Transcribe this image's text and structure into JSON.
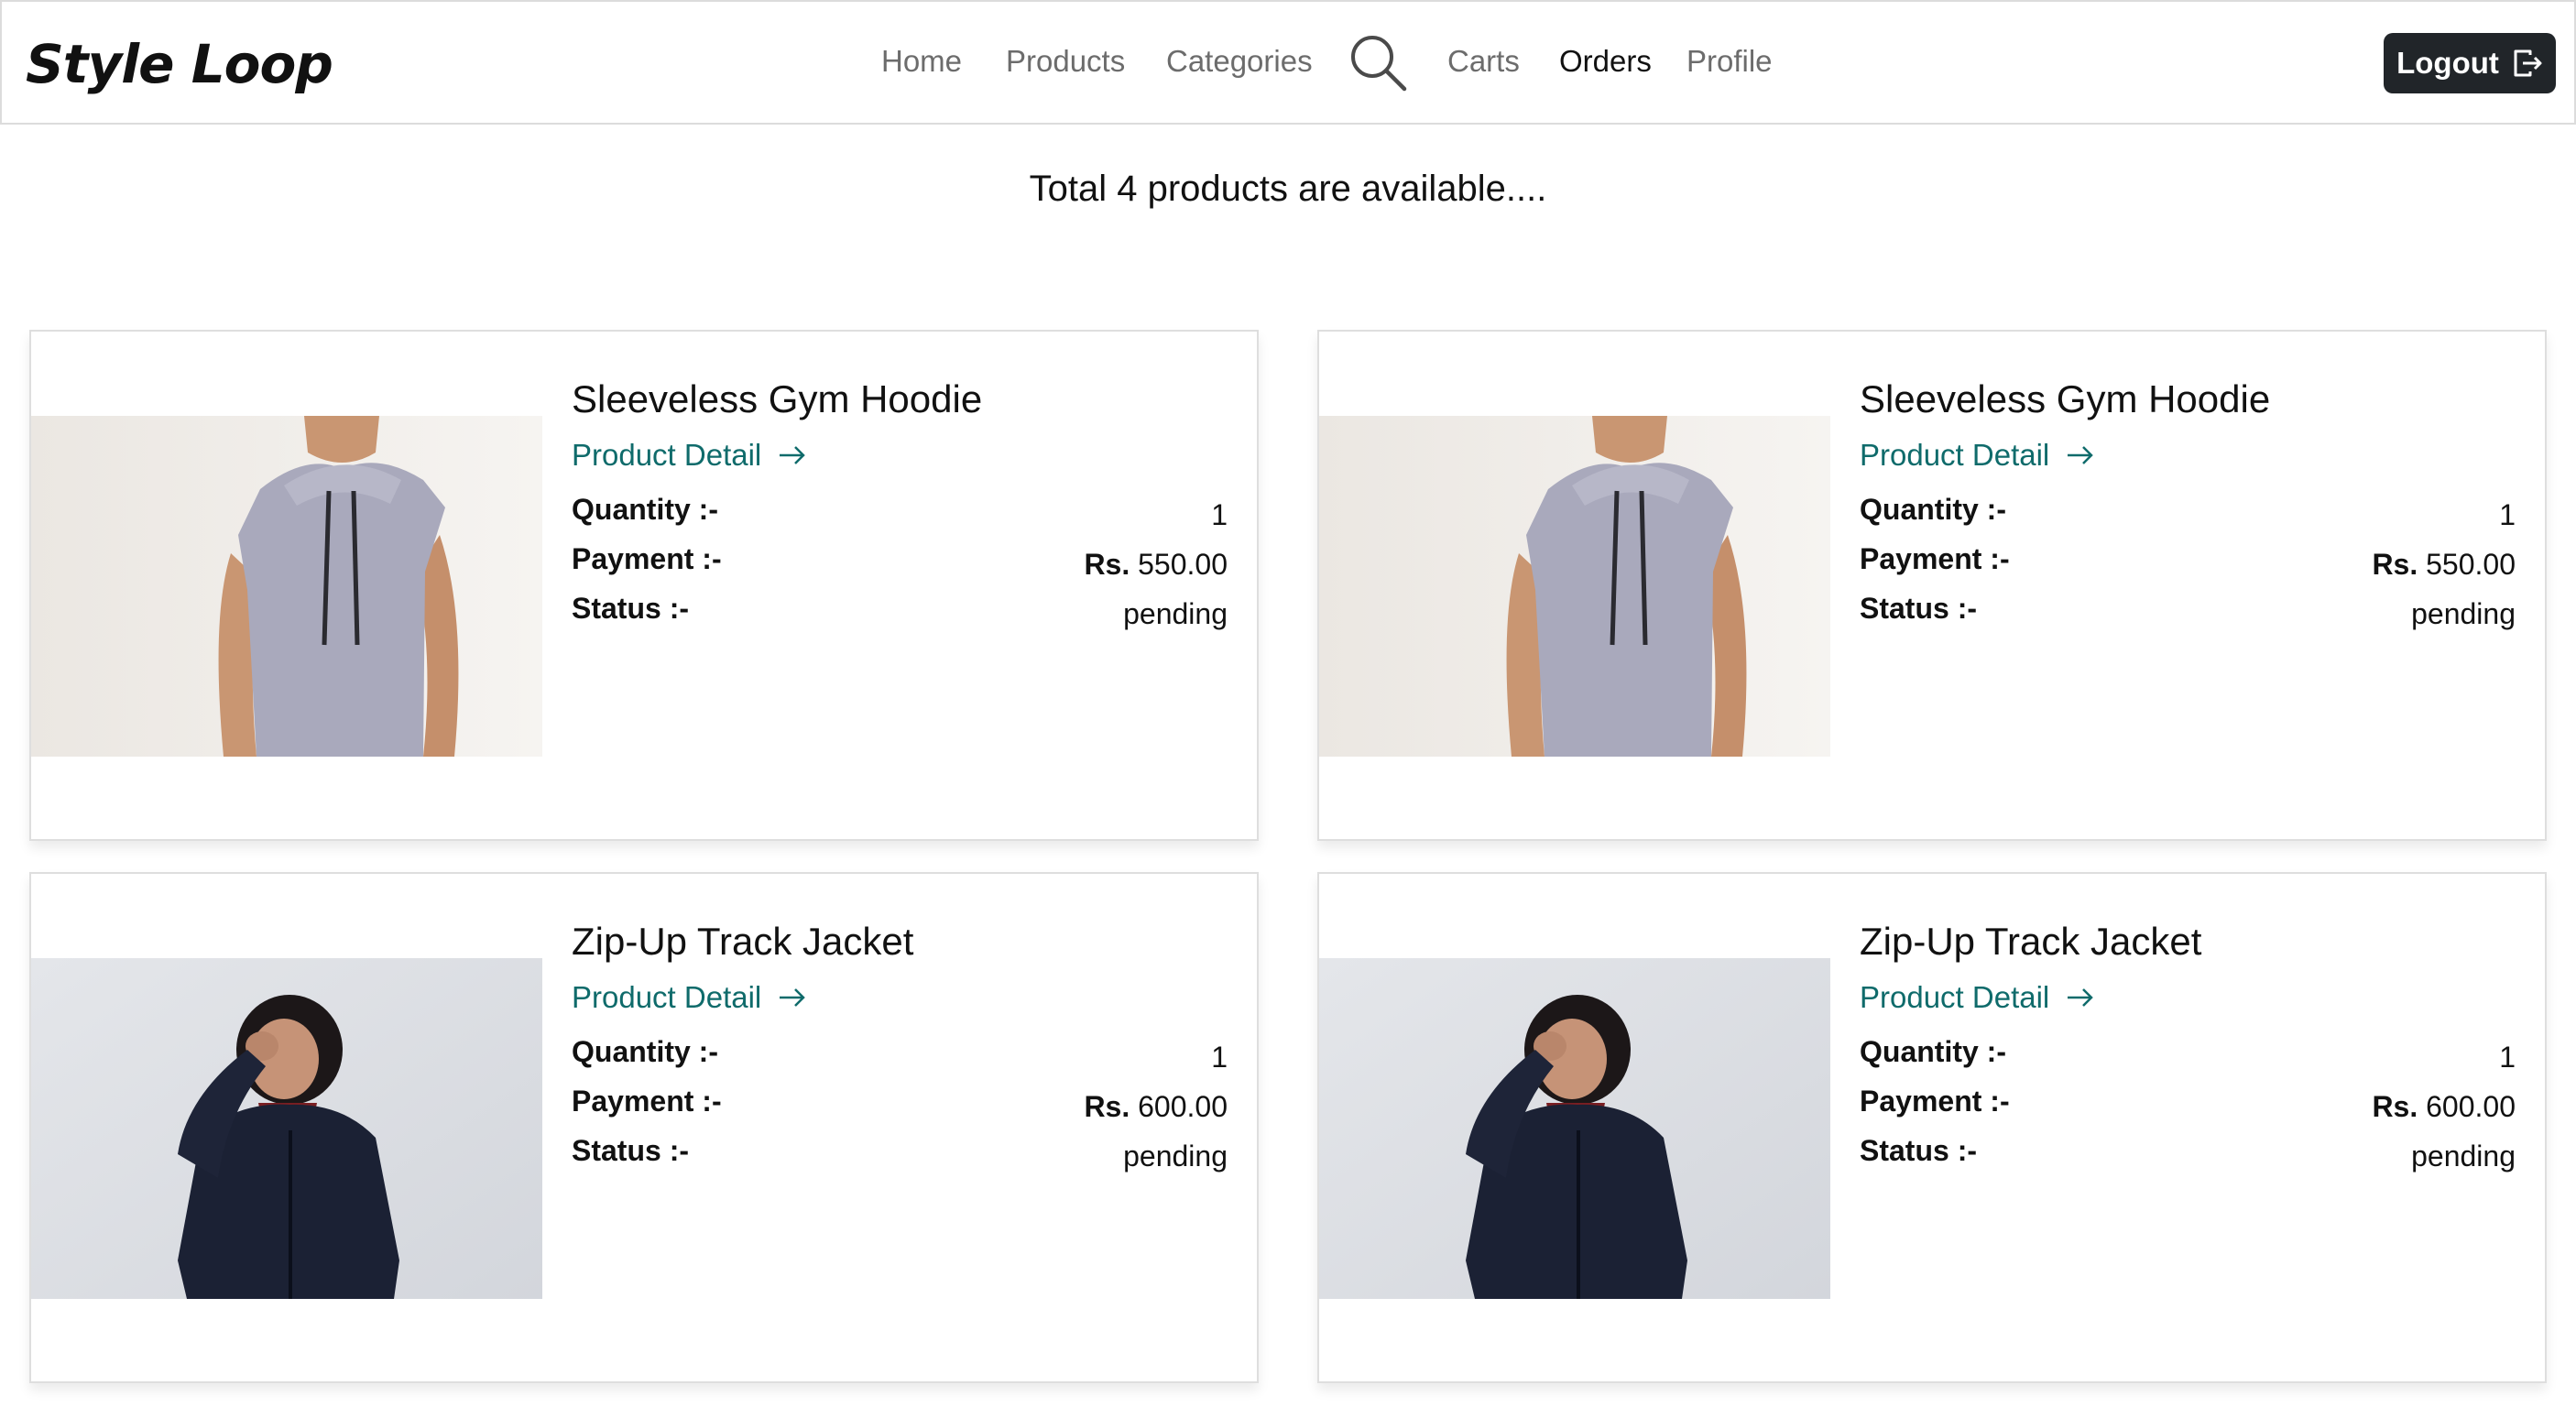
{
  "navbar": {
    "brand": "Style Loop",
    "links": [
      "Home",
      "Products",
      "Categories",
      "Carts",
      "Orders",
      "Profile"
    ],
    "active": "Orders",
    "search_icon": "search-icon",
    "logout_label": "Logout",
    "logout_icon": "box-arrow-right-icon"
  },
  "heading": "Total 4 products are available....",
  "orders": [
    {
      "title": "Sleeveless Gym Hoodie",
      "detail_link": "Product Detail",
      "quantity_label": "Quantity :-",
      "quantity": "1",
      "payment_label": "Payment :-",
      "currency": "Rs.",
      "payment": "550.00",
      "status_label": "Status :-",
      "status": "pending",
      "image": "sleeveless-hoodie-photo"
    },
    {
      "title": "Sleeveless Gym Hoodie",
      "detail_link": "Product Detail",
      "quantity_label": "Quantity :-",
      "quantity": "1",
      "payment_label": "Payment :-",
      "currency": "Rs.",
      "payment": "550.00",
      "status_label": "Status :-",
      "status": "pending",
      "image": "sleeveless-hoodie-photo"
    },
    {
      "title": "Zip-Up Track Jacket",
      "detail_link": "Product Detail",
      "quantity_label": "Quantity :-",
      "quantity": "1",
      "payment_label": "Payment :-",
      "currency": "Rs.",
      "payment": "600.00",
      "status_label": "Status :-",
      "status": "pending",
      "image": "track-jacket-photo"
    },
    {
      "title": "Zip-Up Track Jacket",
      "detail_link": "Product Detail",
      "quantity_label": "Quantity :-",
      "quantity": "1",
      "payment_label": "Payment :-",
      "currency": "Rs.",
      "payment": "600.00",
      "status_label": "Status :-",
      "status": "pending",
      "image": "track-jacket-photo"
    }
  ],
  "colors": {
    "link": "#0f6b6b",
    "logout_bg": "#212529",
    "nav_muted": "#6c6c6c"
  }
}
